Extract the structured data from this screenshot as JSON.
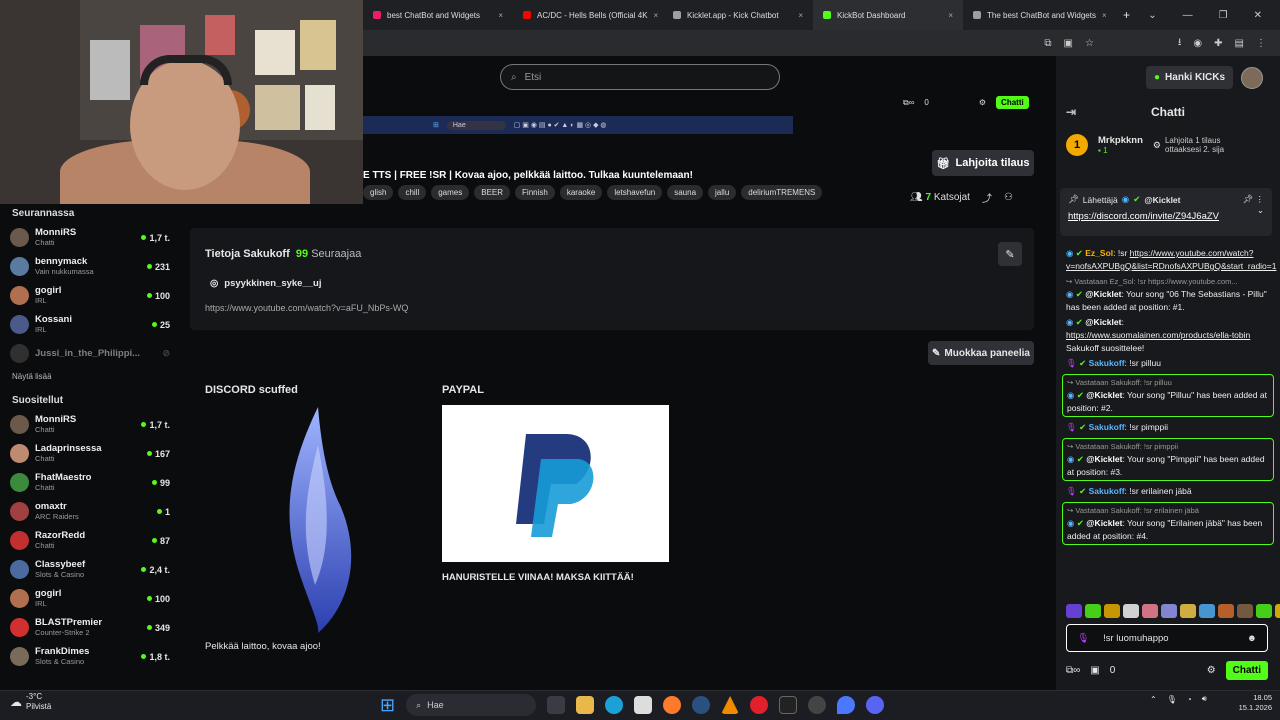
{
  "browser": {
    "tabs": [
      {
        "label": "best ChatBot and Widgets",
        "color": "#e91e63"
      },
      {
        "label": "AC/DC - Hells Bells (Official 4K",
        "color": "#ff0000"
      },
      {
        "label": "Kicklet.app - Kick Chatbot",
        "color": "#9e9e9e"
      },
      {
        "label": "KickBot Dashboard",
        "color": "#53fc18"
      },
      {
        "label": "The best ChatBot and Widgets",
        "color": "#9e9e9e"
      }
    ],
    "new_tab": "+",
    "close": "×"
  },
  "header": {
    "search_placeholder": "Etsi",
    "hanki_label": "Hanki KICKs"
  },
  "overlay": {
    "search": "Hae",
    "links": "0",
    "chat": "Chatti"
  },
  "stream": {
    "title": "E TTS | FREE !SR | Kovaa ajoo, pelkkää laittoo. Tulkaa kuuntelemaan!",
    "tags": [
      "glish",
      "chill",
      "games",
      "BEER",
      "Finnish",
      "karaoke",
      "letshavefun",
      "sauna",
      "jallu",
      "deliriumTREMENS"
    ],
    "gift_button": "Lahjoita tilaus",
    "viewers": "7",
    "viewers_label": "Katsojat"
  },
  "sidebar": {
    "following_title": "Seurannassa",
    "following": [
      {
        "name": "MonniRS",
        "sub": "Chatti",
        "viewers": "1,7 t.",
        "color": "#6b5a4b",
        "live": true
      },
      {
        "name": "bennymack",
        "sub": "Vain nukkumassa",
        "viewers": "231",
        "color": "#5a7aa0",
        "live": true
      },
      {
        "name": "gogirl",
        "sub": "IRL",
        "viewers": "100",
        "color": "#b07050",
        "live": true
      },
      {
        "name": "Kossani",
        "sub": "IRL",
        "viewers": "25",
        "color": "#4a5a8a",
        "live": true
      },
      {
        "name": "Jussi_in_the_Philippi...",
        "sub": "",
        "viewers": "",
        "color": "#555",
        "live": false
      }
    ],
    "show_more": "Näytä lisää",
    "recommended_title": "Suositellut",
    "recommended": [
      {
        "name": "MonniRS",
        "sub": "Chatti",
        "viewers": "1,7 t.",
        "color": "#6b5a4b"
      },
      {
        "name": "Ladaprinsessa",
        "sub": "Chatti",
        "viewers": "167",
        "color": "#c08a70"
      },
      {
        "name": "FhatMaestro",
        "sub": "Chatti",
        "viewers": "99",
        "color": "#3c8a3c"
      },
      {
        "name": "omaxtr",
        "sub": "ARC Raiders",
        "viewers": "1",
        "color": "#a04040"
      },
      {
        "name": "RazorRedd",
        "sub": "Chatti",
        "viewers": "87",
        "color": "#c03030"
      },
      {
        "name": "Classybeef",
        "sub": "Slots & Casino",
        "viewers": "2,4 t.",
        "color": "#4a6aa0"
      },
      {
        "name": "gogirl",
        "sub": "IRL",
        "viewers": "100",
        "color": "#b07050"
      },
      {
        "name": "BLASTPremier",
        "sub": "Counter-Strike 2",
        "viewers": "349",
        "color": "#d03030"
      },
      {
        "name": "FrankDimes",
        "sub": "Slots & Casino",
        "viewers": "1,8 t.",
        "color": "#7a6a5a"
      }
    ]
  },
  "about": {
    "title": "Tietoja Sakukoff",
    "followers": "99",
    "followers_label": "Seuraajaa",
    "instagram": "psyykkinen_syke__uj",
    "link": "https://www.youtube.com/watch?v=aFU_NbPs-WQ",
    "edit_panel": "Muokkaa paneelia"
  },
  "panels": {
    "discord_title": "DISCORD scuffed",
    "discord_caption": "Pelkkää laittoo, kovaa ajoo!",
    "paypal_title": "PAYPAL",
    "paypal_caption": "HANURISTELLE VIINAA! MAKSA KIITTÄÄ!"
  },
  "chat": {
    "title": "Chatti",
    "top_gifter": {
      "rank": "1",
      "name": "Mrkpkknn",
      "count": "1",
      "info": "Lahjoita 1 tilaus ottaaksesi 2. sija"
    },
    "pinned": {
      "label": "Lähettäjä",
      "user": "@Kicklet",
      "url": "https://discord.com/invite/Z94J6aZV"
    },
    "messages": [
      {
        "reply": "",
        "user": "Ez_Sol",
        "user_color": "#f5b400",
        "text": ": !sr ",
        "link": "https://www.youtube.com/watch?v=nofsAXPUBgQ&list=RDnofsAXPUBgQ&start_radio=1",
        "boxed": false
      },
      {
        "reply": "Vastataan Ez_Sol: !sr https://www.youtube.com...",
        "user": "@Kicklet",
        "user_color": "#ffffff",
        "text": ": Your song \"06 The Sebastians - Pillu\" has been added at position: #1.",
        "link": "",
        "boxed": false
      },
      {
        "reply": "",
        "user": "@Kicklet",
        "user_color": "#ffffff",
        "text": ": ",
        "link": "https://www.suomalainen.com/products/ella-tobin",
        "tail": "Sakukoff suosittelee!",
        "boxed": false
      },
      {
        "reply": "",
        "user": "Sakukoff",
        "user_color": "#53b7ff",
        "text": ": !sr pilluu",
        "link": "",
        "boxed": false
      },
      {
        "reply": "Vastataan Sakukoff: !sr pilluu",
        "user": "@Kicklet",
        "user_color": "#ffffff",
        "text": ": Your song \"Pilluu\" has been added at position: #2.",
        "link": "",
        "boxed": true
      },
      {
        "reply": "",
        "user": "Sakukoff",
        "user_color": "#53b7ff",
        "text": ": !sr pimppii",
        "link": "",
        "boxed": false
      },
      {
        "reply": "Vastataan Sakukoff: !sr pimppii",
        "user": "@Kicklet",
        "user_color": "#ffffff",
        "text": ": Your song \"Pimppii\" has been added at position: #3.",
        "link": "",
        "boxed": true
      },
      {
        "reply": "",
        "user": "Sakukoff",
        "user_color": "#53b7ff",
        "text": ": !sr erilainen jäbä",
        "link": "",
        "boxed": false
      },
      {
        "reply": "Vastataan Sakukoff: !sr erilainen jäbä",
        "user": "@Kicklet",
        "user_color": "#ffffff",
        "text": ": Your song \"Erilainen jäbä\" has been added at position: #4.",
        "link": "",
        "boxed": true
      }
    ],
    "input_value": "!sr luomuhappo",
    "links_count": "0",
    "send_label": "Chatti"
  },
  "taskbar": {
    "temp": "-3°C",
    "weather": "Pilvistä",
    "search": "Hae",
    "time": "18.05",
    "date": "15.1.2026"
  }
}
